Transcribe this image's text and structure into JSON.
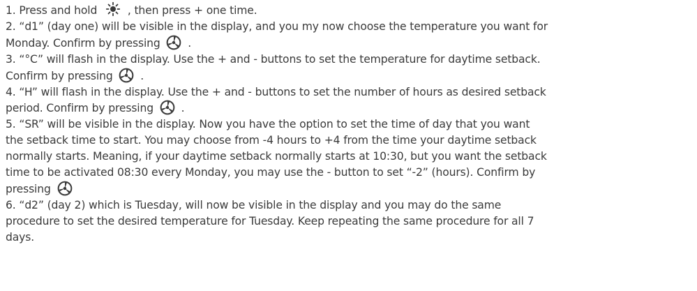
{
  "steps": [
    {
      "id": 1,
      "line1_before": "1. Press and hold ",
      "line1_after": " , then press + one time."
    },
    {
      "id": 2,
      "line1": "2. “d1” (day one) will be visible in the display, and you my now choose the temperature you want for",
      "line2_before": "Monday. Confirm by pressing ",
      "line2_after": " ."
    },
    {
      "id": 3,
      "line1": "3. “°C” will flash in the display. Use the + and - buttons to set the temperature for daytime setback.",
      "line2_before": "Confirm by pressing ",
      "line2_after": " ."
    },
    {
      "id": 4,
      "line1": "4. “H” will flash in the display. Use the + and - buttons to set the number of hours as desired setback",
      "line2_before": "period. Confirm by pressing ",
      "line2_after": " ."
    },
    {
      "id": 5,
      "line1": "5. “SR” will be visible in the display. Now you have the option to set the time of day that you want",
      "line2": "the setback time to start. You may choose from -4 hours to +4 from the time your daytime setback",
      "line3": "normally starts. Meaning, if your daytime setback normally starts at 10:30, but you want the setback",
      "line4": "time to be activated 08:30 every Monday, you may use the - button to set “-2” (hours). Confirm by",
      "line5_before": "pressing "
    },
    {
      "id": 6,
      "line1": "6. “d2” (day 2) which is Tuesday, will now be visible in the display and you may do the same",
      "line2": "procedure to set the desired temperature for Tuesday. Keep repeating the same procedure for all 7",
      "line3": "days."
    }
  ],
  "icons": {
    "sun": "sun-icon",
    "confirm": "confirm-button-icon"
  },
  "colors": {
    "text": "#3a3a3a",
    "icon": "#3a3a3a",
    "background": "#ffffff"
  }
}
